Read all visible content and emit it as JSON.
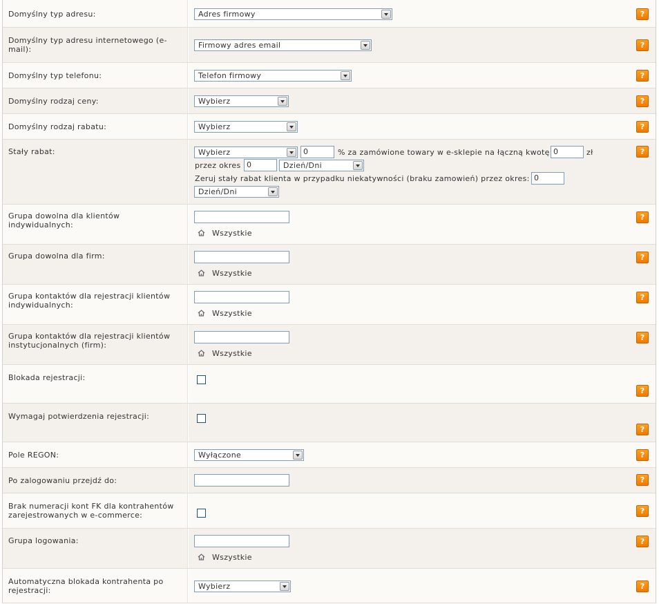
{
  "help_symbol": "?",
  "rows": {
    "adres": {
      "label": "Domyślny typ adresu:",
      "select": "Adres firmowy"
    },
    "email": {
      "label": "Domyślny typ adresu internetowego (e-mail):",
      "select": "Firmowy adres email"
    },
    "telefon": {
      "label": "Domyślny typ telefonu:",
      "select": "Telefon firmowy"
    },
    "cena": {
      "label": "Domyślny rodzaj ceny:",
      "select": "Wybierz"
    },
    "rabat": {
      "label": "Domyślny rodzaj rabatu:",
      "select": "Wybierz"
    },
    "staly": {
      "label": "Stały rabat:",
      "select": "Wybierz",
      "percent_value": "0",
      "text1": "% za zamówione towary w e-sklepie na łączną kwotę",
      "amount_value": "0",
      "currency": "zł",
      "period_label": "przez okres",
      "period_value": "0",
      "period_unit": "Dzień/Dni",
      "reset_text": "Zeruj stały rabat klienta w przypadku niekatywności (braku zamowień) przez okres:",
      "reset_value": "0",
      "reset_unit": "Dzień/Dni"
    },
    "grupa_ind": {
      "label": "Grupa dowolna dla klientów indywidualnych:",
      "value": "",
      "link": "Wszystkie"
    },
    "grupa_firm": {
      "label": "Grupa dowolna dla firm:",
      "value": "",
      "link": "Wszystkie"
    },
    "kontakt_ind": {
      "label": "Grupa kontaktów dla rejestracji klientów indywidualnych:",
      "value": "",
      "link": "Wszystkie"
    },
    "kontakt_inst": {
      "label": "Grupa kontaktów dla rejestracji klientów instytucjonalnych (firm):",
      "value": "",
      "link": "Wszystkie"
    },
    "blokada": {
      "label": "Blokada rejestracji:",
      "checked": false
    },
    "potwierdzenie": {
      "label": "Wymagaj potwierdzenia rejestracji:",
      "checked": false
    },
    "regon": {
      "label": "Pole REGON:",
      "select": "Wyłączone"
    },
    "zalogowanie": {
      "label": "Po zalogowaniu przejdź do:",
      "value": ""
    },
    "fk": {
      "label": "Brak numeracji kont FK dla kontrahentów zarejestrowanych w e-commerce:",
      "checked": false
    },
    "logowanie": {
      "label": "Grupa logowania:",
      "value": "",
      "link": "Wszystkie"
    },
    "auto_blokada": {
      "label": "Automatyczna blokada kontrahenta po rejestracji:",
      "select": "Wybierz"
    }
  }
}
